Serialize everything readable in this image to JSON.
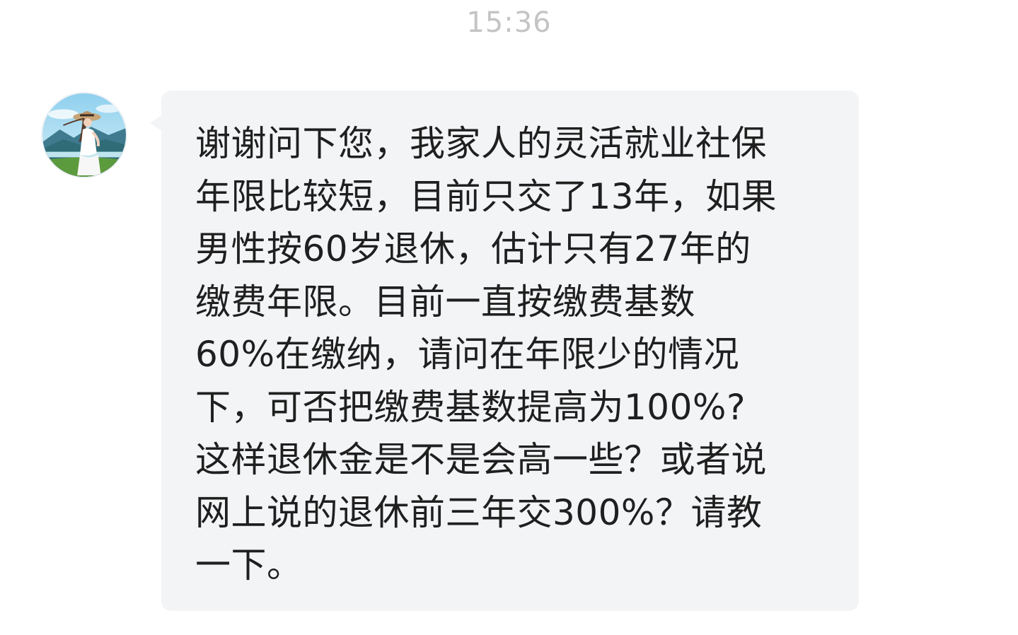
{
  "header": {
    "timestamp": "15:36"
  },
  "message": {
    "sender_avatar_icon": "avatar-woman-sunhat-icon",
    "lines": [
      "谢谢问下您，我家人的灵活就业社保",
      "年限比较短，目前只交了13年，如果",
      "男性按60岁退休，估计只有27年的",
      "缴费年限。目前一直按缴费基数",
      "60%在缴纳，请问在年限少的情况",
      "下，可否把缴费基数提高为100%?",
      "这样退休金是不是会高一些？或者说",
      "网上说的退休前三年交300%？请教",
      "一下。"
    ]
  },
  "colors": {
    "background": "#ffffff",
    "bubble": "#f3f4f6",
    "text": "#1f1f1f",
    "timestamp": "#c4c4c4"
  }
}
